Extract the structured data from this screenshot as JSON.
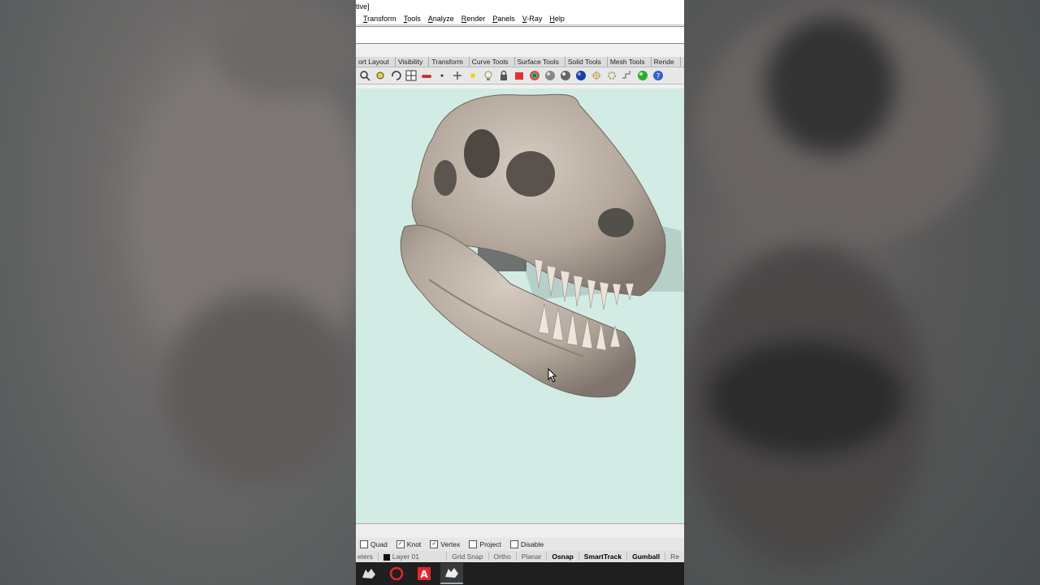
{
  "window": {
    "title_fragment": "tive]"
  },
  "menu": [
    "Transform",
    "Tools",
    "Analyze",
    "Render",
    "Panels",
    "V-Ray",
    "Help"
  ],
  "tabs": [
    "ort Layout",
    "Visibility",
    "Transform",
    "Curve Tools",
    "Surface Tools",
    "Solid Tools",
    "Mesh Tools",
    "Rende"
  ],
  "toolbar_icons": [
    "zoom-window-icon",
    "zoom-extents-icon",
    "rotate-view-icon",
    "four-viewports-icon",
    "car-icon",
    "point-icon",
    "pan-icon",
    "light-icon",
    "bulb-icon",
    "lock-icon",
    "material-icon",
    "color-wheel-icon",
    "shaded-sphere-icon",
    "rendered-sphere-icon",
    "blue-sphere-icon",
    "render-spark-icon",
    "gear-icon",
    "snap-grid-icon",
    "green-sphere-icon",
    "help-icon"
  ],
  "osnap": {
    "items": [
      {
        "label": "Quad",
        "checked": false
      },
      {
        "label": "Knot",
        "checked": true
      },
      {
        "label": "Vertex",
        "checked": true
      },
      {
        "label": "Project",
        "checked": false
      },
      {
        "label": "Disable",
        "checked": false
      }
    ]
  },
  "status": {
    "units": "eters",
    "layer": "Layer 01",
    "panes": [
      {
        "label": "Grid Snap",
        "bold": false
      },
      {
        "label": "Ortho",
        "bold": false
      },
      {
        "label": "Planar",
        "bold": false
      },
      {
        "label": "Osnap",
        "bold": true
      },
      {
        "label": "SmartTrack",
        "bold": true
      },
      {
        "label": "Gumball",
        "bold": true
      },
      {
        "label": "Re",
        "bold": false
      }
    ]
  },
  "taskbar": [
    "rhino-icon",
    "opera-icon",
    "autocad-icon",
    "rhino-active-icon"
  ],
  "colors": {
    "viewport": "#d2ebe5",
    "skull": "#b0a49a"
  }
}
